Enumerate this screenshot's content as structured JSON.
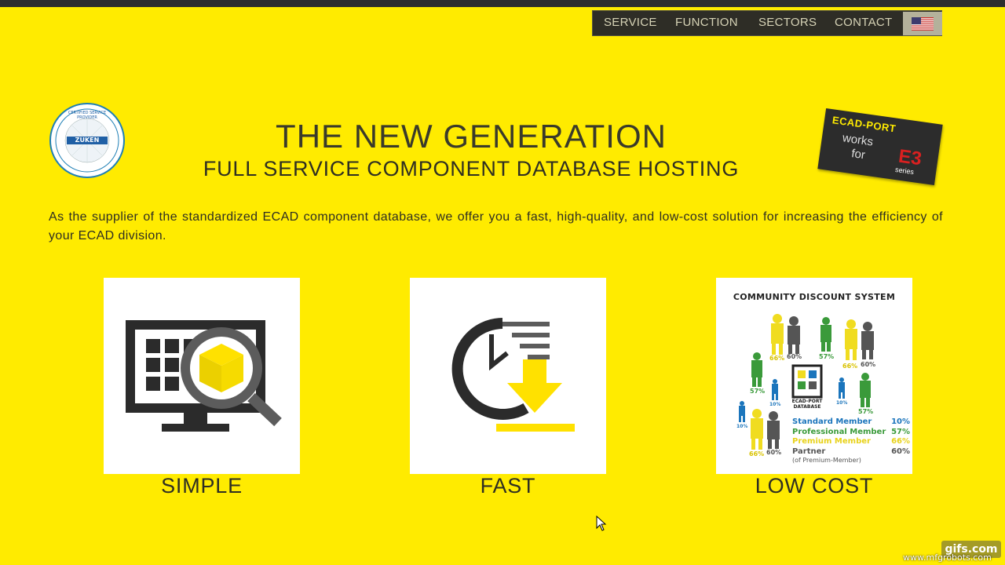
{
  "nav": {
    "items": [
      "SERVICE",
      "FUNCTION",
      "SECTORS",
      "CONTACT"
    ],
    "language_icon": "us-flag-icon"
  },
  "hero": {
    "title": "THE NEW GENERATION",
    "subtitle": "FULL SERVICE COMPONENT DATABASE HOSTING",
    "intro": "As the supplier of the standardized ECAD component database, we offer you a fast, high-quality, and low-cost solution for increasing the efficiency of your ECAD division."
  },
  "seal": {
    "text_top": "CERTIFIED SERVICE PROVIDER",
    "brand": "ZUKEN"
  },
  "badge": {
    "brand": "ECAD-PORT",
    "works": "works",
    "for": "for",
    "e3": "E3",
    "series": "series"
  },
  "features": [
    {
      "label": "SIMPLE",
      "icon": "monitor-search-cube-icon"
    },
    {
      "label": "FAST",
      "icon": "clock-download-icon"
    },
    {
      "label": "LOW COST",
      "icon": "community-discount-icon"
    }
  ],
  "community": {
    "title": "COMMUNITY  DISCOUNT SYSTEM",
    "db_label_1": "ECAD-PORT",
    "db_label_2": "DATABASE",
    "figure_pcts": [
      "66%",
      "60%",
      "57%",
      "66%",
      "60%",
      "57%",
      "10%",
      "10%",
      "57%",
      "10%",
      "66%",
      "60%"
    ],
    "legend": [
      {
        "name": "Standard Member",
        "value": "10%",
        "color": "#1b75bc"
      },
      {
        "name": "Professional Member",
        "value": "57%",
        "color": "#3a9a3a"
      },
      {
        "name": "Premium Member",
        "value": "66%",
        "color": "#f0dc20"
      },
      {
        "name": "Partner",
        "value": "60%",
        "color": "#555555"
      }
    ],
    "legend_note": "(of Premium-Member)"
  },
  "colors": {
    "background": "#ffeb00",
    "nav_bg": "#2e2d26",
    "text": "#2e2e22"
  },
  "watermark": {
    "site": "gifs.com",
    "url": "www.mfgrobots.com"
  }
}
